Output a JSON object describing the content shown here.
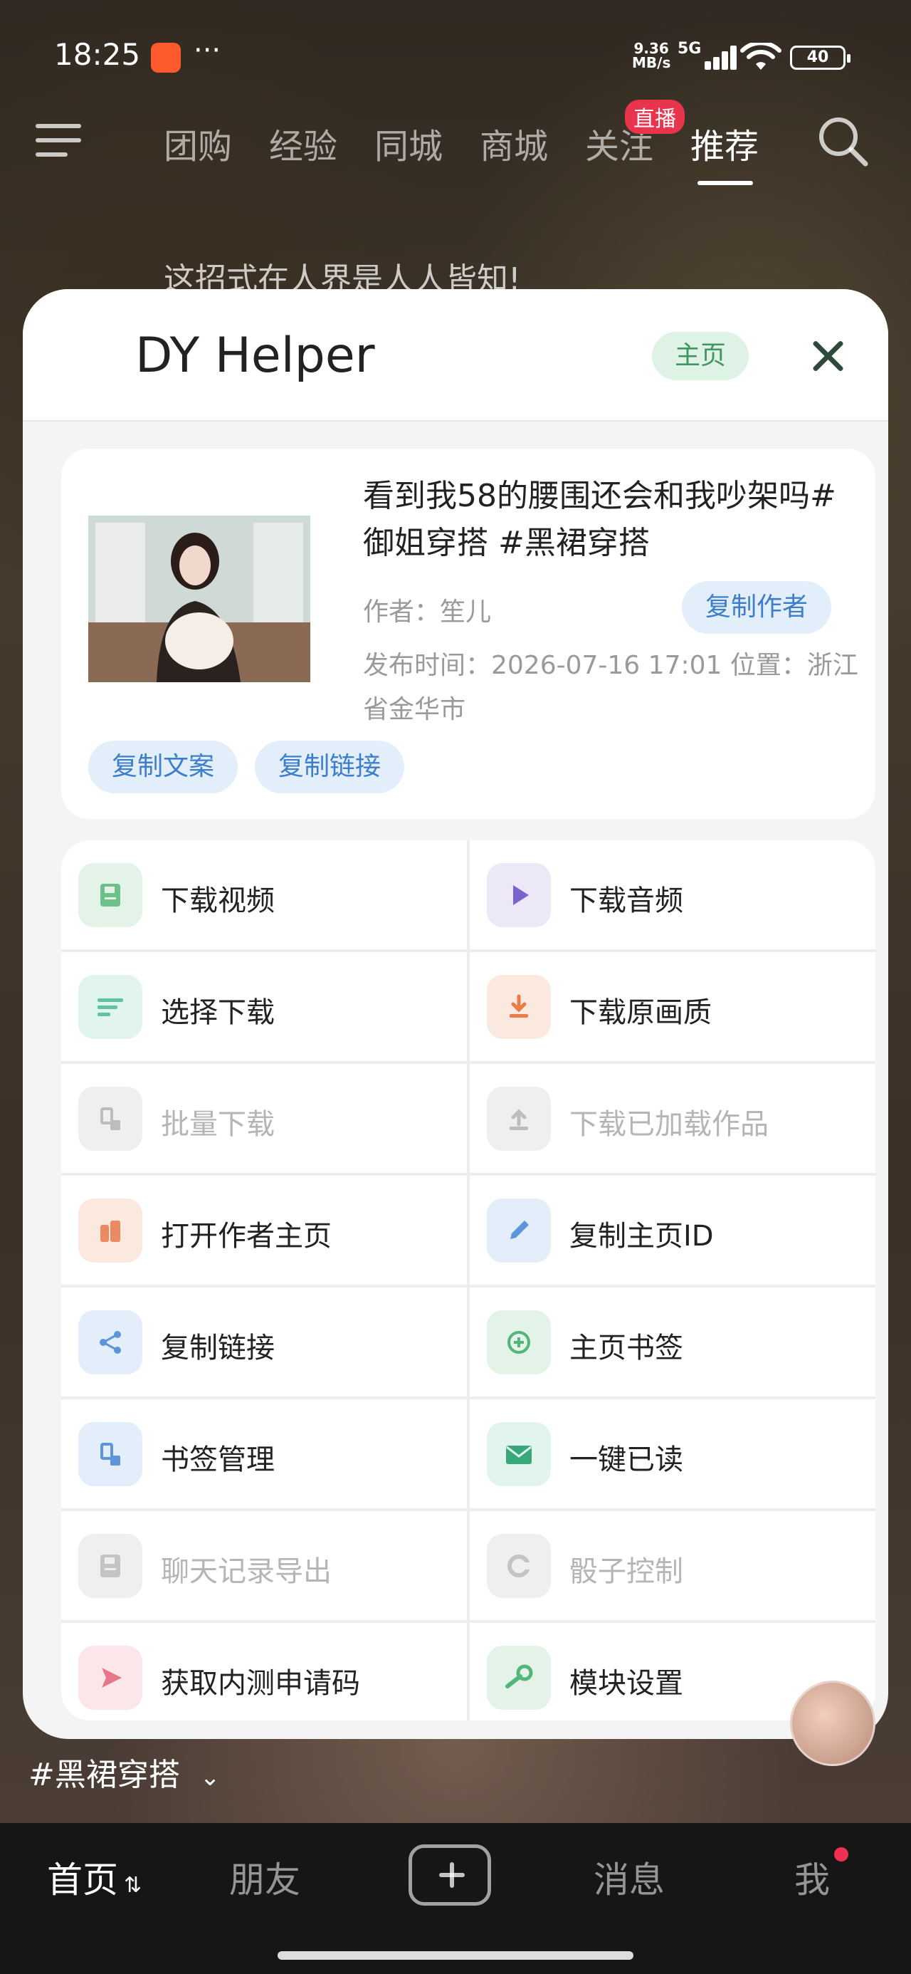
{
  "status": {
    "time": "18:25",
    "net_speed_value": "9.36",
    "net_speed_unit": "MB/s",
    "signal": "5G",
    "battery": "40"
  },
  "topnav": {
    "tabs": [
      "团购",
      "经验",
      "同城",
      "商城",
      "关注",
      "推荐"
    ],
    "active_tab": "推荐",
    "live_badge": "直播",
    "overlay_text": "这招式在人界是人人皆知!"
  },
  "panel": {
    "title": "DY Helper",
    "home_label": "主页",
    "video": {
      "title": "看到我58的腰围还会和我吵架吗#御姐穿搭 #黑裙穿搭",
      "author": "作者：笙儿",
      "copy_author": "复制作者",
      "meta": "发布时间：2026-07-16 17:01  位置：浙江省金华市",
      "copy_caption": "复制文案",
      "copy_link": "复制链接"
    },
    "actions": [
      {
        "label": "下载视频",
        "icon": "save-icon",
        "disabled": false
      },
      {
        "label": "下载音频",
        "icon": "play-icon",
        "disabled": false
      },
      {
        "label": "选择下载",
        "icon": "list-icon",
        "disabled": false
      },
      {
        "label": "下载原画质",
        "icon": "download-icon",
        "disabled": false
      },
      {
        "label": "批量下载",
        "icon": "batch-icon",
        "disabled": true
      },
      {
        "label": "下载已加载作品",
        "icon": "upload-icon",
        "disabled": true
      },
      {
        "label": "打开作者主页",
        "icon": "author-icon",
        "disabled": false
      },
      {
        "label": "复制主页ID",
        "icon": "pencil-icon",
        "disabled": false
      },
      {
        "label": "复制链接",
        "icon": "share-icon",
        "disabled": false
      },
      {
        "label": "主页书签",
        "icon": "plus-circle-icon",
        "disabled": false
      },
      {
        "label": "书签管理",
        "icon": "bookmark-manage-icon",
        "disabled": false
      },
      {
        "label": "一键已读",
        "icon": "mail-icon",
        "disabled": false
      },
      {
        "label": "聊天记录导出",
        "icon": "export-icon",
        "disabled": true
      },
      {
        "label": "骰子控制",
        "icon": "dice-icon",
        "disabled": true
      },
      {
        "label": "获取内测申请码",
        "icon": "send-icon",
        "disabled": false
      },
      {
        "label": "模块设置",
        "icon": "wrench-icon",
        "disabled": false
      }
    ]
  },
  "tagline": "#黑裙穿搭",
  "bottom_nav": {
    "home": "首页",
    "friends": "朋友",
    "messages": "消息",
    "me": "我"
  }
}
